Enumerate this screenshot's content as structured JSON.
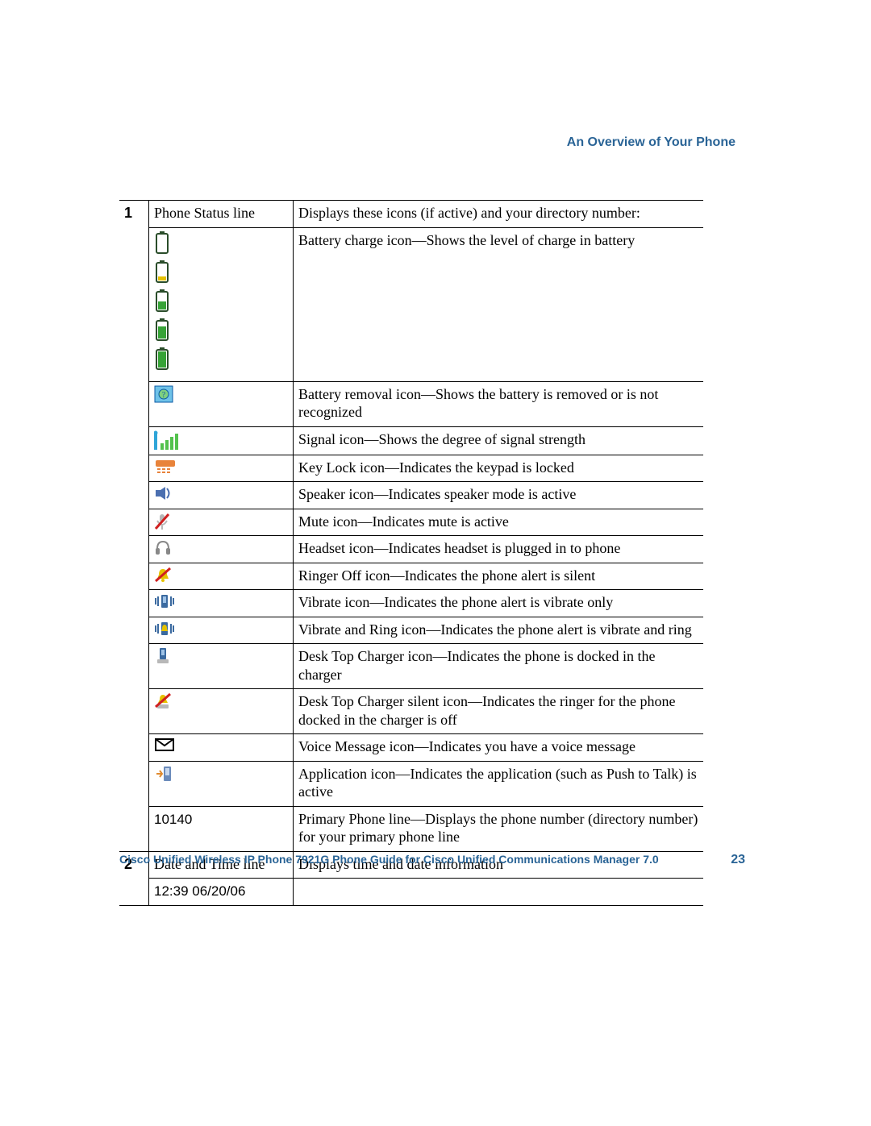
{
  "page_header_right": "An Overview of Your Phone",
  "footer_title": "Cisco Unified Wireless IP Phone 7921G Phone Guide for Cisco Unified Communications Manager 7.0",
  "page_number": "23",
  "row_num_1": "1",
  "row1_label": "Phone Status line",
  "row1_desc": "Displays these icons (if active) and your directory number:",
  "battery_desc": "Battery charge icon—Shows the level of charge in battery",
  "battrem_desc": "Battery removal icon—Shows the battery is removed or is not recognized",
  "signal_desc": "Signal icon—Shows the degree of signal strength",
  "keylock_desc": "Key Lock icon—Indicates the keypad is locked",
  "speaker_desc": "Speaker icon—Indicates speaker mode is active",
  "mute_desc": "Mute icon—Indicates mute is active",
  "headset_desc": "Headset icon—Indicates headset is plugged in to phone",
  "ringer_desc": "Ringer Off icon—Indicates the phone alert is silent",
  "vibrate_desc": "Vibrate icon—Indicates the phone alert is vibrate only",
  "vibring_desc": "Vibrate and Ring icon—Indicates the phone alert is vibrate and ring",
  "charger_desc": "Desk Top Charger icon—Indicates the phone is docked in the charger",
  "chargersil_desc": "Desk Top Charger silent icon—Indicates the ringer for the phone docked in the charger is off",
  "voicemail_desc": "Voice Message icon—Indicates you have a voice message",
  "app_desc": "Application icon—Indicates the application (such as Push to Talk) is active",
  "primary_number": "10140",
  "primary_desc": "Primary Phone line—Displays the phone number (directory number) for your primary phone line",
  "row_num_2": "2",
  "row2_label": "Date and Time line",
  "row2_desc": "Displays time and date information",
  "datetime_example": "12:39 06/20/06"
}
